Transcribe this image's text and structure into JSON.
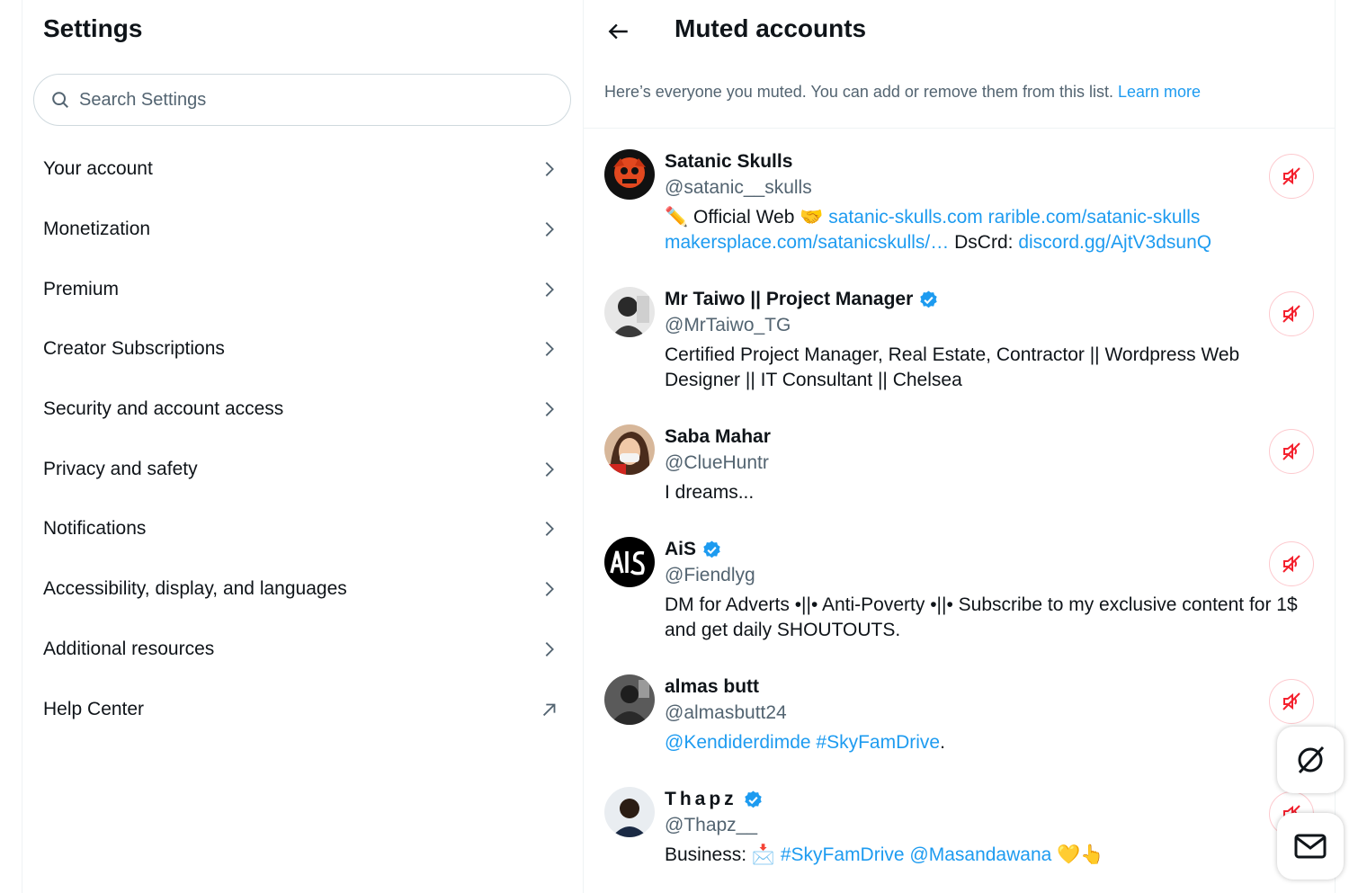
{
  "settings": {
    "title": "Settings",
    "search_placeholder": "Search Settings",
    "items": [
      {
        "label": "Your account",
        "icon": "chevron-right-icon"
      },
      {
        "label": "Monetization",
        "icon": "chevron-right-icon"
      },
      {
        "label": "Premium",
        "icon": "chevron-right-icon"
      },
      {
        "label": "Creator Subscriptions",
        "icon": "chevron-right-icon"
      },
      {
        "label": "Security and account access",
        "icon": "chevron-right-icon"
      },
      {
        "label": "Privacy and safety",
        "icon": "chevron-right-icon"
      },
      {
        "label": "Notifications",
        "icon": "chevron-right-icon"
      },
      {
        "label": "Accessibility, display, and languages",
        "icon": "chevron-right-icon"
      },
      {
        "label": "Additional resources",
        "icon": "chevron-right-icon"
      },
      {
        "label": "Help Center",
        "icon": "external-link-icon"
      }
    ]
  },
  "muted": {
    "title": "Muted accounts",
    "intro": "Here’s everyone you muted. You can add or remove them from this list.",
    "learn_more": "Learn more",
    "accounts": [
      {
        "name": "Satanic Skulls",
        "handle": "@satanic__skulls",
        "verified": false,
        "bio_prefix": "✏️ Official Web 🤝",
        "bio_link1": "satanic-skulls.com rarible.com/satanic-skulls makersplace.com/satanicskulls/…",
        "bio_mid": "DsCrd:",
        "bio_link2": "discord.gg/AjtV3dsunQ"
      },
      {
        "name": "Mr Taiwo || Project Manager",
        "handle": "@MrTaiwo_TG",
        "verified": true,
        "bio": "Certified Project Manager, Real Estate, Contractor || Wordpress Web Designer || IT Consultant || Chelsea"
      },
      {
        "name": "Saba Mahar",
        "handle": "@ClueHuntr",
        "verified": false,
        "bio": "I dreams..."
      },
      {
        "name": "AiS",
        "handle": "@Fiendlyg",
        "verified": true,
        "bio": "DM for Adverts •||• Anti-Poverty •||• Subscribe to my exclusive content for 1$ and get daily SHOUTOUTS."
      },
      {
        "name": "almas butt",
        "handle": "@almasbutt24",
        "verified": false,
        "bio_link": "@Kendiderdimde #SkyFamDrive",
        "bio_suffix": "."
      },
      {
        "name": "Thapz",
        "handle": "@Thapz__",
        "verified": true,
        "bio_prefix": "Business: 📩",
        "bio_link": "#SkyFamDrive @Masandawana",
        "bio_suffix": "💛👆"
      }
    ]
  },
  "colors": {
    "accent": "#1d9bf0",
    "mute_red": "#f4212e",
    "text_primary": "#0f1419",
    "text_secondary": "#536471"
  },
  "fabs": [
    {
      "icon": "grok-icon"
    },
    {
      "icon": "messages-icon"
    }
  ]
}
